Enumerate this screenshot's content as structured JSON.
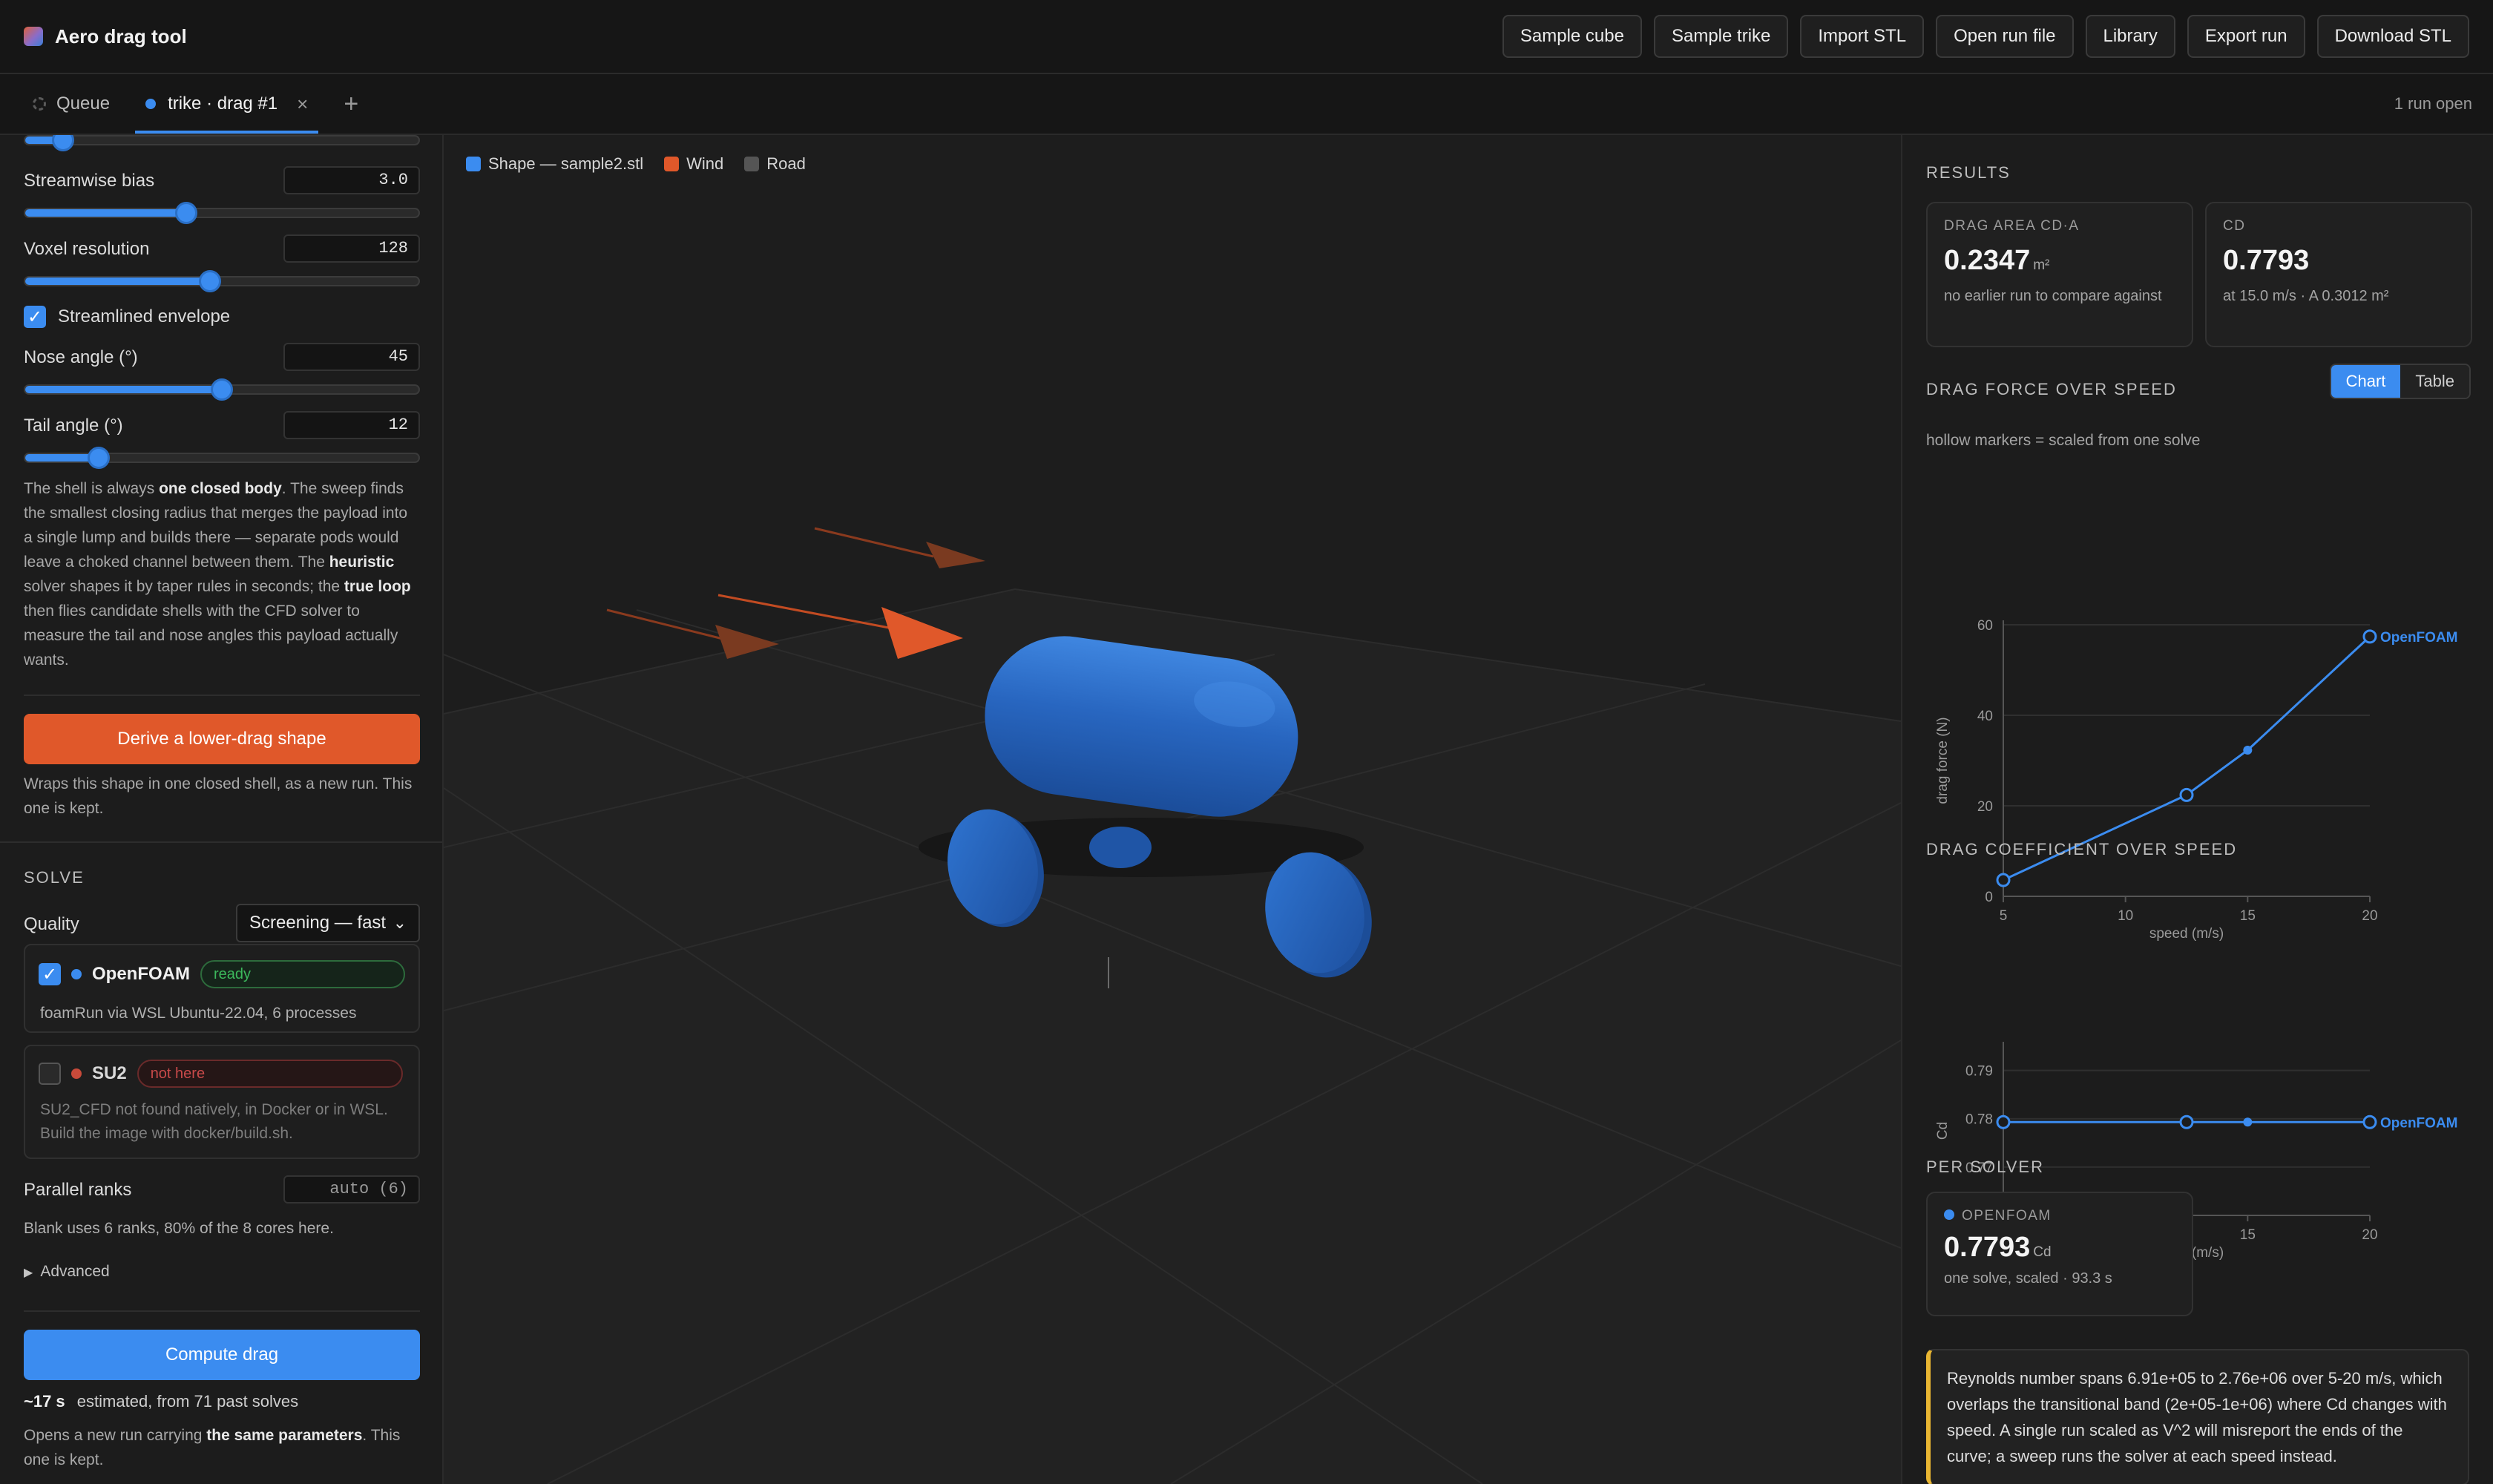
{
  "app": {
    "title": "Aero drag tool"
  },
  "topbar": {
    "buttons": [
      "Sample cube",
      "Sample trike",
      "Import STL",
      "Open run file",
      "Library",
      "Export run",
      "Download STL"
    ]
  },
  "tabs": {
    "queue": "Queue",
    "active": "trike · drag #1",
    "close": "×",
    "add": "+",
    "status": "1 run open"
  },
  "left": {
    "streamwise_bias": {
      "label": "Streamwise bias",
      "value": "3.0",
      "fraction": 0.41
    },
    "voxel_resolution": {
      "label": "Voxel resolution",
      "value": "128",
      "fraction": 0.47
    },
    "top_slider_fraction": 0.1,
    "streamlined": {
      "label": "Streamlined envelope",
      "checked": true
    },
    "nose_angle": {
      "label": "Nose angle (°)",
      "value": "45",
      "fraction": 0.5
    },
    "tail_angle": {
      "label": "Tail angle (°)",
      "value": "12",
      "fraction": 0.19
    },
    "description": {
      "p1": "The shell is always ",
      "b1": "one closed body",
      "p2": ". The sweep finds the smallest closing radius that merges the payload into a single lump and builds there — separate pods would leave a choked channel between them. The ",
      "b2": "heuristic",
      "p3": " solver shapes it by taper rules in seconds; the ",
      "b3": "true loop",
      "p4": " then flies candidate shells with the CFD solver to measure the tail and nose angles this payload actually wants."
    },
    "derive_button": "Derive a lower-drag shape",
    "derive_note": "Wraps this shape in one closed shell, as a new run. This one is kept.",
    "solve_title": "SOLVE",
    "quality": {
      "label": "Quality",
      "value": "Screening — fast"
    },
    "solvers": [
      {
        "name": "OpenFOAM",
        "status": "ready",
        "detail": "foamRun via WSL Ubuntu-22.04, 6 processes",
        "checked": true,
        "color": "#3b8cf0"
      },
      {
        "name": "SU2",
        "status": "not here",
        "detail": "SU2_CFD not found natively, in Docker or in WSL. Build the image with docker/build.sh.",
        "checked": false,
        "color": "#c84a3a"
      }
    ],
    "parallel": {
      "label": "Parallel ranks",
      "value": "auto (6)",
      "note": "Blank uses 6 ranks, 80% of the 8 cores here."
    },
    "advanced": "Advanced",
    "compute_button": "Compute drag",
    "estimate": {
      "value": "~17 s",
      "text": "estimated, from 71 past solves"
    },
    "compute_note": {
      "p1": "Opens a new run carrying ",
      "b1": "the same parameters",
      "p2": ". This one is kept."
    }
  },
  "viewport": {
    "legend": [
      {
        "label": "Shape — sample2.stl",
        "color": "#3b8cf0"
      },
      {
        "label": "Wind",
        "color": "#e0582a"
      },
      {
        "label": "Road",
        "color": "#555555"
      }
    ]
  },
  "right": {
    "results_title": "RESULTS",
    "drag_area": {
      "label": "DRAG AREA CD·A",
      "value": "0.2347",
      "unit": "m²",
      "sub": "no earlier run to compare against"
    },
    "cd": {
      "label": "CD",
      "value": "0.7793",
      "sub": "at 15.0 m/s · A 0.3012 m²"
    },
    "force_title": "DRAG FORCE OVER SPEED",
    "toggle": {
      "chart": "Chart",
      "table": "Table"
    },
    "force_note": "hollow markers = scaled from one solve",
    "coef_title": "DRAG COEFFICIENT OVER SPEED",
    "per_solver_title": "PER SOLVER",
    "per_solver": {
      "name": "OPENFOAM",
      "value": "0.7793",
      "unit": "Cd",
      "sub": "one solve, scaled · 93.3 s"
    },
    "note": "Reynolds number spans 6.91e+05 to 2.76e+06 over 5-20 m/s, which overlaps the transitional band (2e+05-1e+06) where Cd changes with speed. A single run scaled as V^2 will misreport the ends of the curve; a sweep runs the solver at each speed instead."
  },
  "chart_data": [
    {
      "type": "line",
      "xlabel": "speed (m/s)",
      "ylabel": "drag force (N)",
      "xlim": [
        5,
        20
      ],
      "ylim": [
        0,
        60
      ],
      "xticks": [
        5,
        10,
        15,
        20
      ],
      "yticks": [
        0,
        20,
        40,
        60
      ],
      "series": [
        {
          "name": "OpenFOAM",
          "color": "#3b8cf0",
          "x": [
            5,
            12.5,
            15,
            20
          ],
          "y": [
            3.6,
            22.4,
            32.3,
            57.4
          ],
          "hollow": [
            true,
            true,
            false,
            true
          ]
        }
      ]
    },
    {
      "type": "line",
      "xlabel": "speed (m/s)",
      "ylabel": "Cd",
      "xlim": [
        5,
        20
      ],
      "ylim": [
        0.76,
        0.795
      ],
      "xticks": [
        5,
        10,
        15,
        20
      ],
      "yticks": [
        0.76,
        0.77,
        0.78,
        0.79
      ],
      "series": [
        {
          "name": "OpenFOAM",
          "color": "#3b8cf0",
          "x": [
            5,
            12.5,
            15,
            20
          ],
          "y": [
            0.7793,
            0.7793,
            0.7793,
            0.7793
          ],
          "hollow": [
            true,
            true,
            false,
            true
          ]
        }
      ]
    }
  ]
}
